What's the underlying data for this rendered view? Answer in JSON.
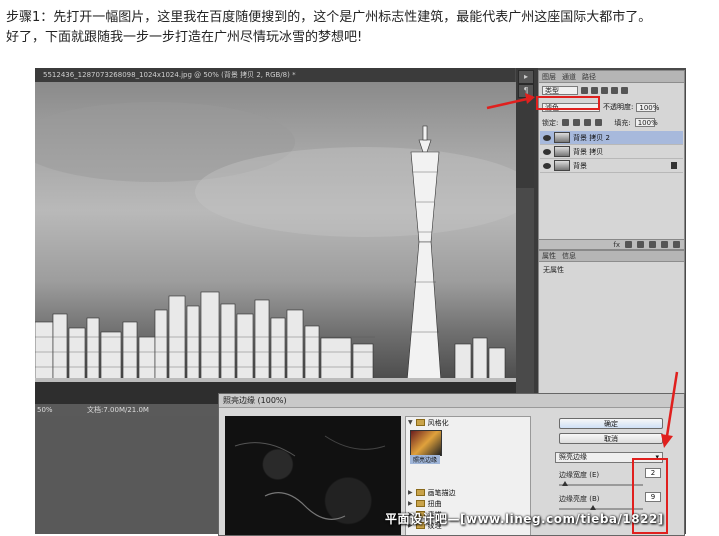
{
  "intro": {
    "line1": "步骤1：先打开一幅图片，这里我在百度随便搜到的，这个是广州标志性建筑，最能代表广州这座国际大都市了。",
    "line2": "好了，下面就跟随我一步一步打造在广州尽情玩冰雪的梦想吧!"
  },
  "document": {
    "tab_title": "5512436_1287073268098_1024x1024.jpg @ 50% (背景 拷贝 2, RGB/8) *",
    "zoom": "50%",
    "doc_size": "文档:7.00M/21.0M"
  },
  "layers_panel": {
    "tabs": [
      "图层",
      "通道",
      "路径"
    ],
    "filter_label": "类型",
    "blend_mode": "滤色",
    "opacity_label": "不透明度:",
    "opacity": "100%",
    "lock_label": "锁定:",
    "fill_label": "填充:",
    "fill": "100%",
    "layers": [
      {
        "name": "背景 拷贝 2",
        "active": true
      },
      {
        "name": "背景 拷贝",
        "active": false
      },
      {
        "name": "背景",
        "active": false
      }
    ],
    "bottom_icons": [
      "fx",
      "mask",
      "adjust",
      "folder",
      "new",
      "trash"
    ]
  },
  "properties_panel": {
    "tabs": [
      "属性",
      "信息"
    ],
    "body": "无属性"
  },
  "filter_dialog": {
    "title": "照亮边缘 (100%)",
    "category_open": "风格化",
    "selected_filter": "照亮边缘",
    "categories": [
      "画笔描边",
      "扭曲",
      "素描",
      "纹理"
    ],
    "ok_label": "确定",
    "cancel_label": "取消",
    "filter_select": "照亮边缘",
    "params": [
      {
        "label": "边缘宽度 (E)",
        "value": "2",
        "fraction": 0.07
      },
      {
        "label": "边缘亮度 (B)",
        "value": "9",
        "fraction": 0.4
      }
    ]
  },
  "watermark": "平面设计吧—[www.lineg.com/tieba/1822]",
  "colors": {
    "highlight": "#e0201e",
    "active_layer": "#a7b9dc"
  }
}
